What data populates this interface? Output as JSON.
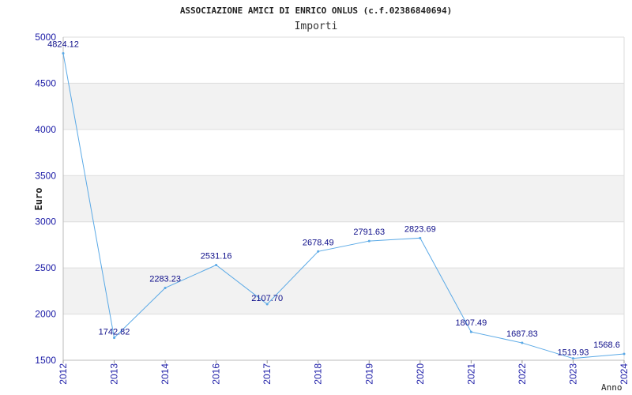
{
  "chart_data": {
    "type": "line",
    "title": "ASSOCIAZIONE AMICI DI ENRICO ONLUS (c.f.02386840694)",
    "subtitle": "Importi",
    "ylabel": "Euro",
    "xlabel": "Anno",
    "ylim": [
      1500,
      5000
    ],
    "yticks": [
      1500,
      2000,
      2500,
      3000,
      3500,
      4000,
      4500,
      5000
    ],
    "categories": [
      "2012",
      "2013",
      "2014",
      "2016",
      "2017",
      "2018",
      "2019",
      "2020",
      "2021",
      "2022",
      "2023",
      "2024"
    ],
    "values": [
      4824.12,
      1742.82,
      2283.23,
      2531.16,
      2107.7,
      2678.49,
      2791.63,
      2823.69,
      1807.49,
      1687.83,
      1519.93,
      1568.6
    ],
    "data_labels": [
      "4824.12",
      "1742.82",
      "2283.23",
      "2531.16",
      "2107.70",
      "2678.49",
      "2791.63",
      "2823.69",
      "1807.49",
      "1687.83",
      "1519.93",
      "1568.6"
    ],
    "grid": "alternating horizontal bands",
    "colors": {
      "line": "#5aa9e6",
      "band": "#f2f2f2",
      "grid": "#dddddd",
      "tick_text": "#1a1aa6",
      "label_text": "#0f0f8a"
    }
  }
}
